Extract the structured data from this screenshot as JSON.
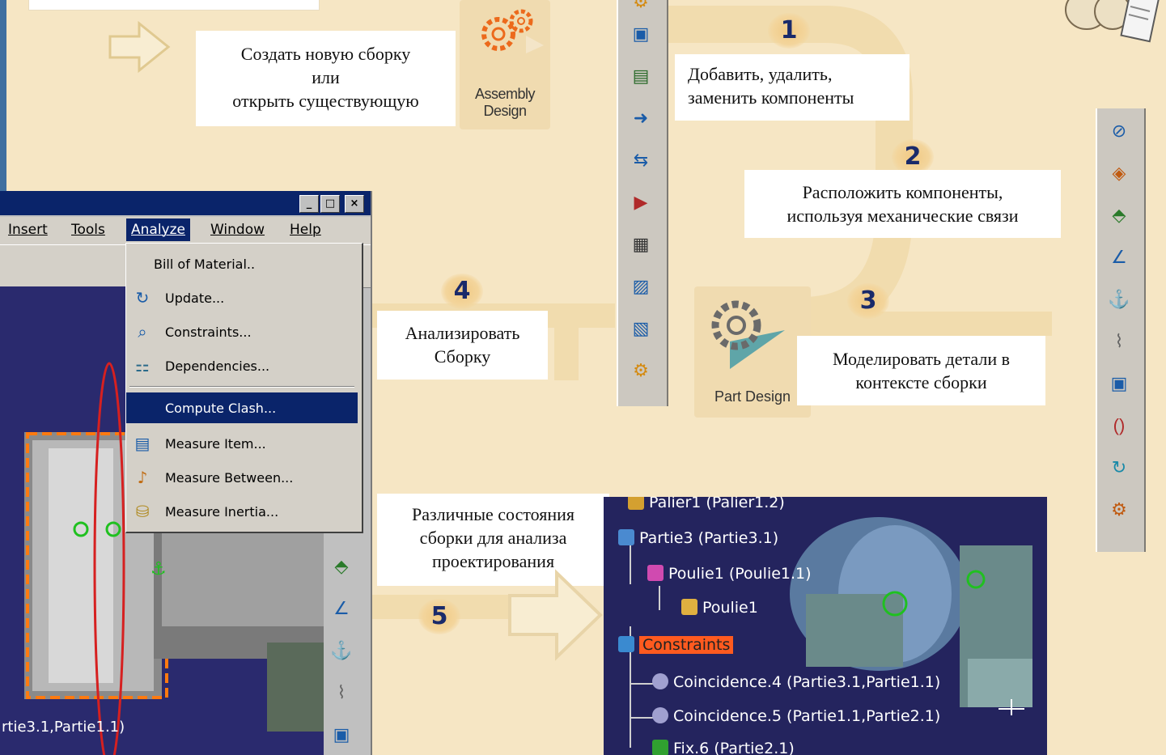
{
  "callouts": {
    "create_assembly": "Создать новую сборку\nили\nоткрыть существующую",
    "add_components": "Добавить, удалить,\nзаменить компоненты",
    "position_components": "Расположить компоненты,\nиспользуя механические связи",
    "analyze_assembly": "Анализировать\nСборку",
    "model_parts": "Моделировать детали в\nконтексте сборки",
    "assembly_states": "Различные состояния\nсборки для анализа\nпроектирования"
  },
  "steps": [
    "1",
    "2",
    "3",
    "4",
    "5"
  ],
  "workbenches": {
    "assembly": "Assembly Design",
    "part": "Part Design"
  },
  "catia_window": {
    "window_buttons": [
      "_",
      "□",
      "×"
    ],
    "menu": {
      "insert": "Insert",
      "tools": "Tools",
      "analyze": "Analyze",
      "window": "Window",
      "help": "Help"
    },
    "analyze_menu": [
      {
        "label": "Bill of Material..",
        "icon": ""
      },
      {
        "label": "Update...",
        "icon": "update-icon"
      },
      {
        "label": "Constraints...",
        "icon": "constraints-icon"
      },
      {
        "label": "Dependencies...",
        "icon": "dependencies-icon"
      },
      {
        "label": "Compute Clash...",
        "icon": ""
      },
      {
        "label": "Measure Item...",
        "icon": "measure-item-icon"
      },
      {
        "label": "Measure Between...",
        "icon": "measure-between-icon"
      },
      {
        "label": "Measure Inertia...",
        "icon": "measure-inertia-icon"
      }
    ],
    "status_text": "rtie3.1,Partie1.1)"
  },
  "spec_tree": [
    {
      "label": "Palier1 (Palier1.2)"
    },
    {
      "label": "Partie3 (Partie3.1)"
    },
    {
      "label": "Poulie1 (Poulie1.1)"
    },
    {
      "label": "Poulie1"
    },
    {
      "label": "Constraints"
    },
    {
      "label": "Coincidence.4 (Partie3.1,Partie1.1)"
    },
    {
      "label": "Coincidence.5 (Partie1.1,Partie2.1)"
    },
    {
      "label": "Fix.6 (Partie2.1)"
    }
  ],
  "colors": {
    "background": "#f6e6c4",
    "step_number": "#1a2a6a",
    "titlebar": "#0a246a",
    "highlight": "#ff5a1f"
  }
}
